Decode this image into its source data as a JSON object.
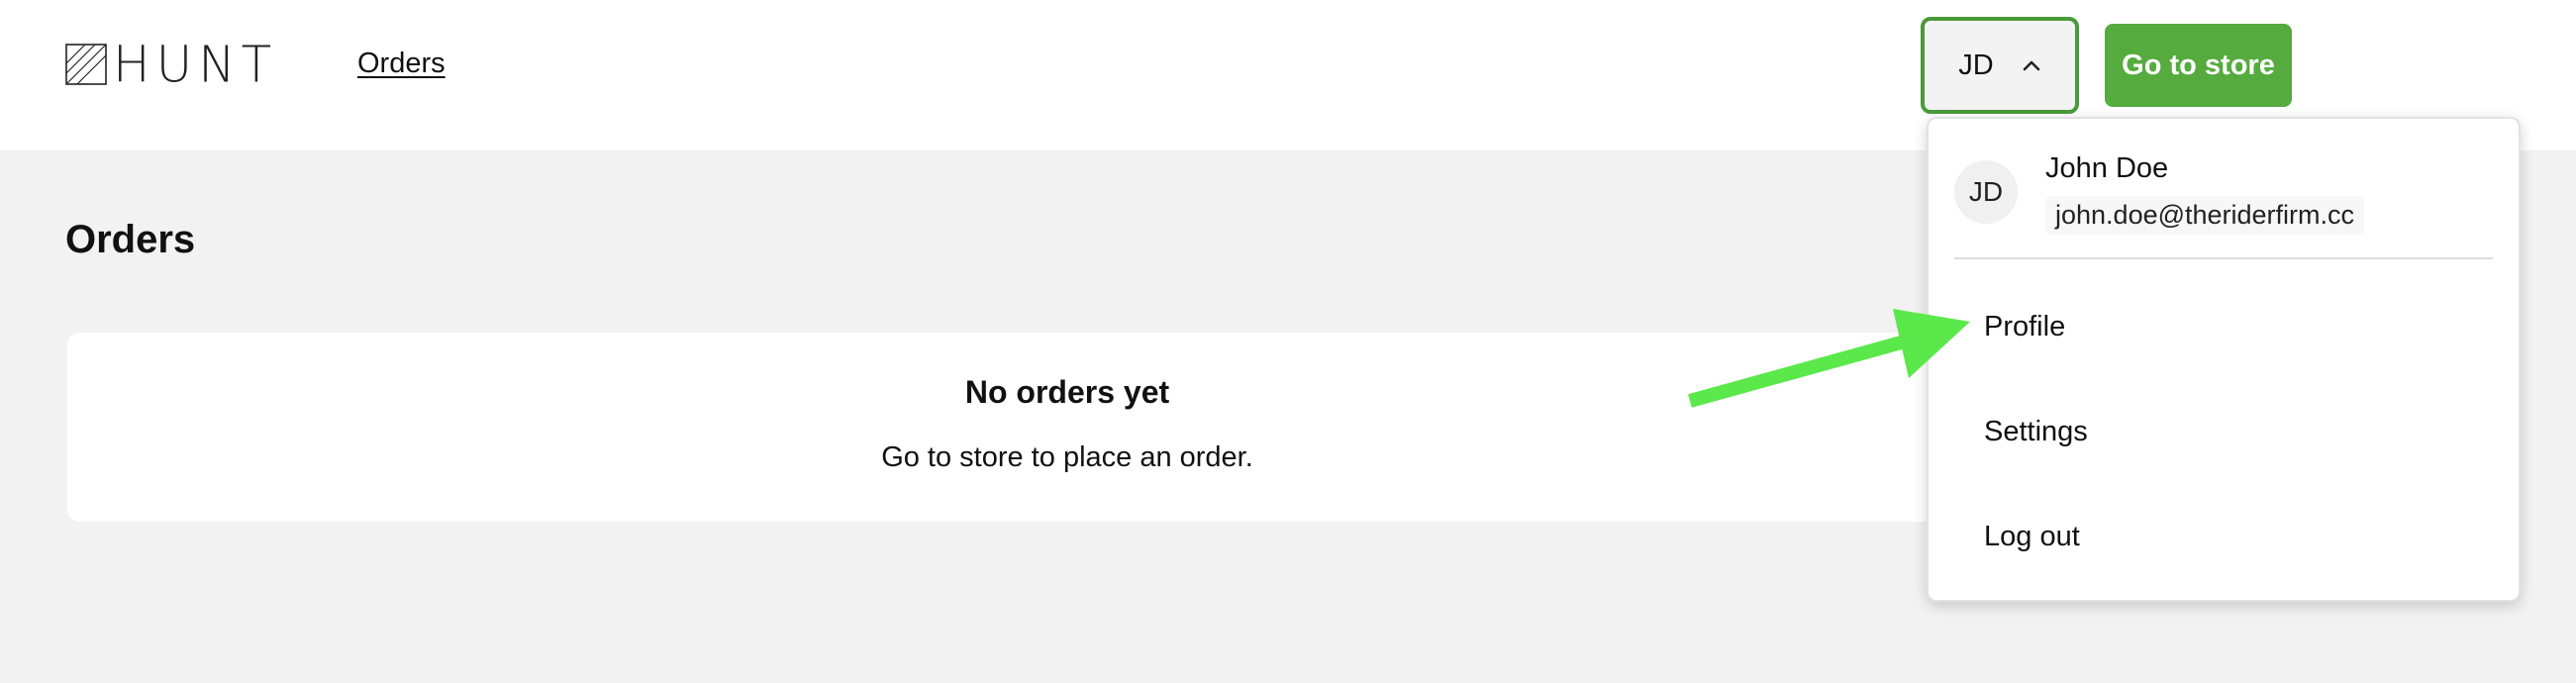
{
  "header": {
    "logo_text": "HUNT",
    "nav": {
      "orders_label": "Orders"
    },
    "user_menu": {
      "initials": "JD",
      "chevron_icon": "chevron-up-icon"
    },
    "store_button_label": "Go to store",
    "accent_color": "#55ab3e"
  },
  "main": {
    "title": "Orders",
    "empty_state": {
      "title": "No orders yet",
      "message": "Go to store to place an order."
    }
  },
  "dropdown": {
    "avatar_initials": "JD",
    "name": "John Doe",
    "email": "john.doe@theriderfirm.cc",
    "items": [
      {
        "label": "Profile"
      },
      {
        "label": "Settings"
      },
      {
        "label": "Log out"
      }
    ]
  },
  "annotation": {
    "arrow_color": "#5ae84a",
    "arrow_icon": "arrow-pointer-icon"
  }
}
